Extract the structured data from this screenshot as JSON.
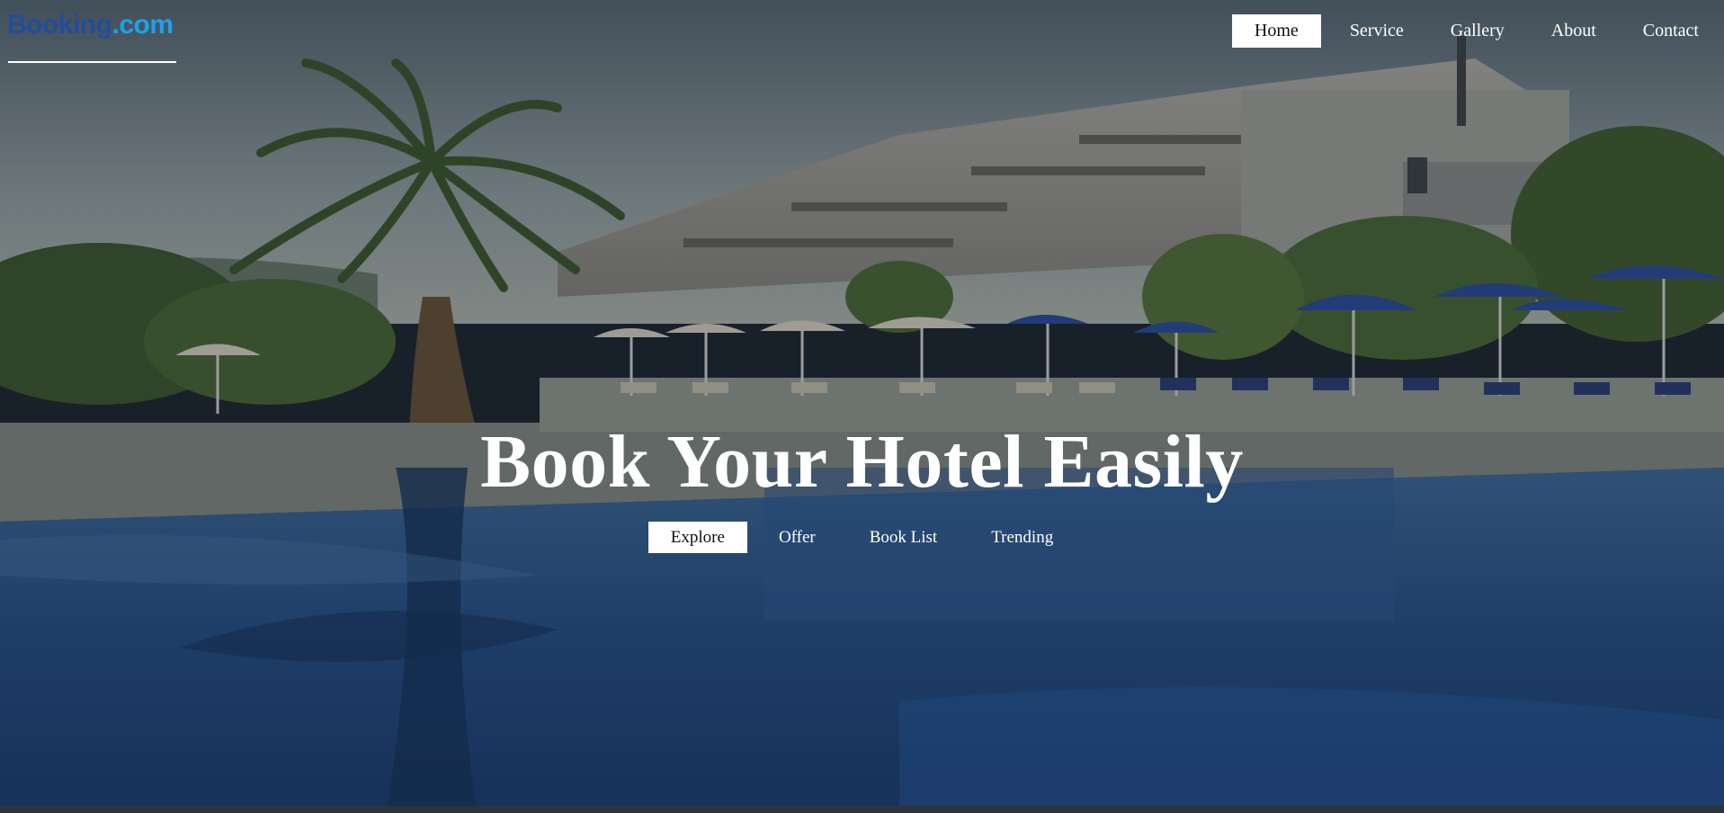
{
  "brand": {
    "name_main": "Booking",
    "name_tld": ".com",
    "color_main": "#1f4e9c",
    "color_tld": "#18a4ec"
  },
  "nav": {
    "items": [
      {
        "label": "Home",
        "active": true
      },
      {
        "label": "Service",
        "active": false
      },
      {
        "label": "Gallery",
        "active": false
      },
      {
        "label": "About",
        "active": false
      },
      {
        "label": "Contact",
        "active": false
      }
    ]
  },
  "hero": {
    "headline": "Book Your Hotel Easily",
    "background": "resort-pool-photo",
    "subnav": [
      {
        "label": "Explore",
        "active": true
      },
      {
        "label": "Offer",
        "active": false
      },
      {
        "label": "Book List",
        "active": false
      },
      {
        "label": "Trending",
        "active": false
      }
    ]
  }
}
